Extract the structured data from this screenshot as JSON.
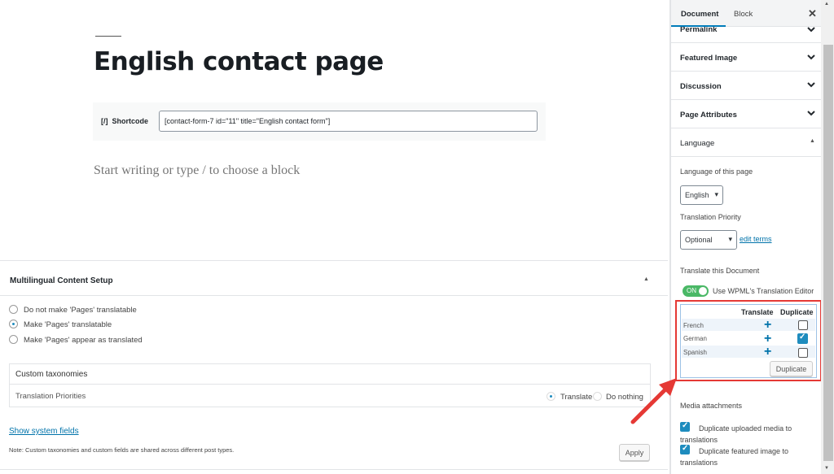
{
  "editor": {
    "title": "English contact page",
    "shortcode_label": "Shortcode",
    "shortcode_icon": "[/]",
    "shortcode_value": "[contact-form-7 id=\"11\" title=\"English contact form\"]",
    "placeholder": "Start writing or type / to choose a block"
  },
  "mcs": {
    "title": "Multilingual Content Setup",
    "options": [
      "Do not make 'Pages' translatable",
      "Make 'Pages' translatable",
      "Make 'Pages' appear as translated"
    ],
    "selected": 1,
    "tax_header": "Custom taxonomies",
    "tax_row": "Translation Priorities",
    "tax_opt1": "Translate",
    "tax_opt2": "Do nothing",
    "show_system": "Show system fields",
    "note": "Note: Custom taxonomies and custom fields are shared across different post types.",
    "apply": "Apply"
  },
  "sidebar": {
    "tab_document": "Document",
    "tab_block": "Block",
    "sections": [
      "Permalink",
      "Featured Image",
      "Discussion",
      "Page Attributes",
      "Language"
    ],
    "lang_label": "Language of this page",
    "lang_value": "English",
    "prio_label": "Translation Priority",
    "prio_value": "Optional",
    "edit_terms": "edit terms",
    "translate_doc": "Translate this Document",
    "toggle_on": "ON",
    "toggle_label": "Use WPML's Translation Editor",
    "col_translate": "Translate",
    "col_duplicate": "Duplicate",
    "languages": [
      {
        "name": "French",
        "dup": false
      },
      {
        "name": "German",
        "dup": true
      },
      {
        "name": "Spanish",
        "dup": false
      }
    ],
    "duplicate_btn": "Duplicate",
    "media_title": "Media attachments",
    "media_opt1": "Duplicate uploaded media to translations",
    "media_opt2": "Duplicate featured image to translations"
  },
  "colors": {
    "accent": "#0073aa",
    "highlight": "#e53935",
    "toggle": "#4ab866"
  }
}
